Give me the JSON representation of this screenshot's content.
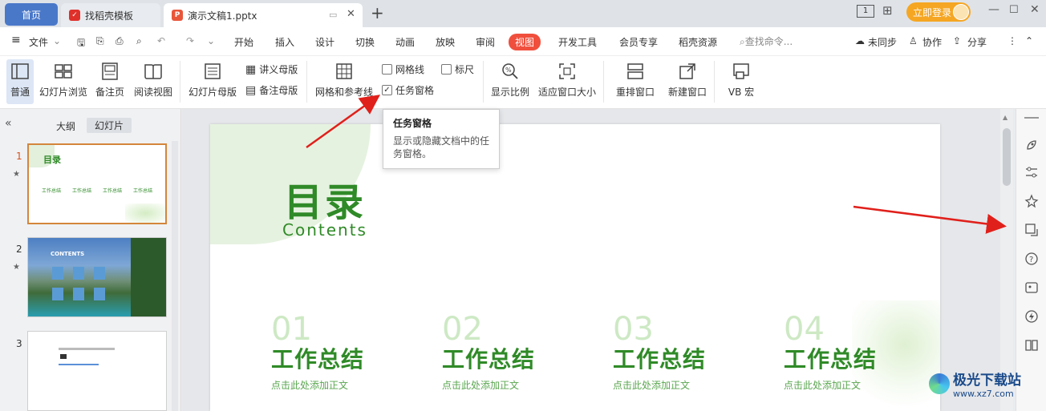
{
  "tabs": {
    "home": "首页",
    "template": "找稻壳模板",
    "doc": "演示文稿1.pptx"
  },
  "account": {
    "login": "立即登录"
  },
  "menu": {
    "file": "文件",
    "items": [
      "开始",
      "插入",
      "设计",
      "切换",
      "动画",
      "放映",
      "审阅",
      "视图",
      "开发工具",
      "会员专享",
      "稻壳资源"
    ],
    "search_placeholder": "查找命令...",
    "sync": "未同步",
    "collab": "协作",
    "share": "分享"
  },
  "ribbon": {
    "normal": "普通",
    "slide_browse": "幻灯片浏览",
    "notes_page": "备注页",
    "reading_view": "阅读视图",
    "slide_master": "幻灯片母版",
    "handout_master": "讲义母版",
    "notes_master": "备注母版",
    "grid_guides": "网格和参考线",
    "gridlines": "网格线",
    "ruler": "标尺",
    "task_pane": "任务窗格",
    "zoom": "显示比例",
    "fit_window": "适应窗口大小",
    "arrange": "重排窗口",
    "new_window": "新建窗口",
    "vb_macro": "VB 宏"
  },
  "checks": {
    "gridlines": false,
    "ruler": false,
    "task_pane": true
  },
  "tooltip": {
    "title": "任务窗格",
    "desc": "显示或隐藏文档中的任务窗格。"
  },
  "panel": {
    "outline": "大纲",
    "slides": "幻灯片",
    "nums": [
      "1",
      "2",
      "3"
    ]
  },
  "thumb1": {
    "title": "目录",
    "item": "工作总结"
  },
  "thumb2": {
    "title": "CONTENTS"
  },
  "slide": {
    "title": "目录",
    "subtitle": "Contents",
    "columns": [
      {
        "num": "01",
        "head": "工作总结",
        "sub": "点击此处添加正文"
      },
      {
        "num": "02",
        "head": "工作总结",
        "sub": "点击此处添加正文"
      },
      {
        "num": "03",
        "head": "工作总结",
        "sub": "点击此处添加正文"
      },
      {
        "num": "04",
        "head": "工作总结",
        "sub": "点击此处添加正文"
      }
    ]
  },
  "watermark": {
    "name": "极光下载站",
    "url": "www.xz7.com"
  },
  "colors": {
    "accent": "#f04f3d",
    "green": "#2f8a27",
    "arrow": "#e0201b"
  }
}
